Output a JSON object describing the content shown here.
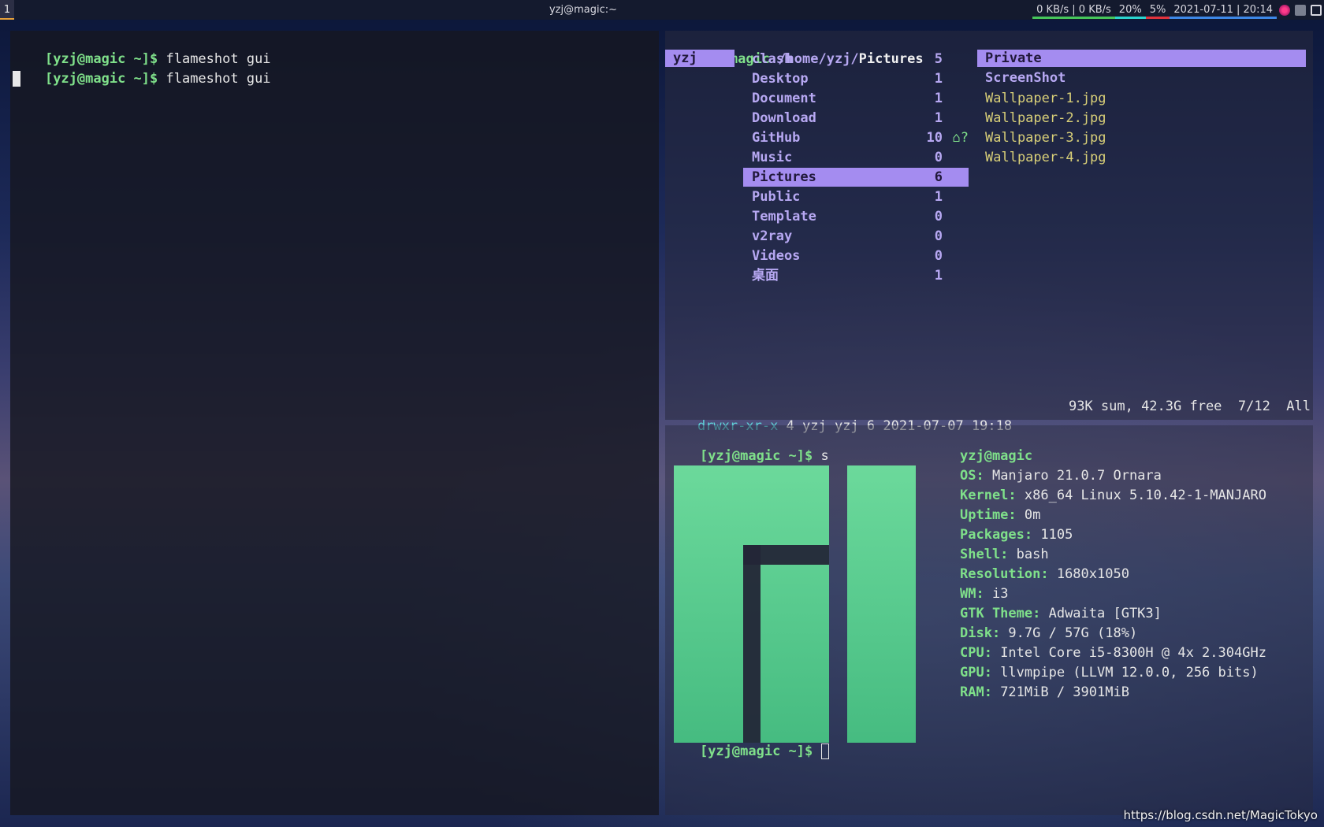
{
  "topbar": {
    "workspace": "1",
    "window_title": "yzj@magic:~",
    "net": "0 KB/s | 0 KB/s",
    "cpu": "20%",
    "mem": "5%",
    "datetime": "2021-07-11 | 20:14",
    "tray_icons": [
      "flameshot-icon",
      "clipboard-icon",
      "network-icon"
    ],
    "colors": {
      "net": "#46c55a",
      "cpu": "#2bd4cf",
      "mem": "#e0333d",
      "date": "#3d87e6",
      "workspace": "#e8a13a"
    }
  },
  "left_terminal": {
    "lines": [
      {
        "prompt": "[yzj@magic ~]$",
        "cmd": " flameshot gui"
      },
      {
        "prompt": "[yzj@magic ~]$",
        "cmd": " flameshot gui"
      }
    ]
  },
  "ranger": {
    "header_user": "yzj@magic",
    "header_path": " /home/yzj/",
    "header_dir": "Pictures",
    "parent": "yzj",
    "dirs": [
      {
        "name": "clash",
        "count": "5"
      },
      {
        "name": "Desktop",
        "count": "1"
      },
      {
        "name": "Document",
        "count": "1"
      },
      {
        "name": "Download",
        "count": "1"
      },
      {
        "name": "GitHub",
        "count": "10",
        "flag": "⌂?"
      },
      {
        "name": "Music",
        "count": "0"
      },
      {
        "name": "Pictures",
        "count": "6"
      },
      {
        "name": "Public",
        "count": "1"
      },
      {
        "name": "Template",
        "count": "0"
      },
      {
        "name": "v2ray",
        "count": "0"
      },
      {
        "name": "Videos",
        "count": "0"
      },
      {
        "name": "桌面",
        "count": "1"
      }
    ],
    "selected_dir_index": 6,
    "preview_dirs": [
      "Private",
      "ScreenShot"
    ],
    "preview_files": [
      "Wallpaper-1.jpg",
      "Wallpaper-2.jpg",
      "Wallpaper-3.jpg",
      "Wallpaper-4.jpg"
    ],
    "status_perm": "drwxr-xr-x",
    "status_info": " 4 yzj yzj 6 2021-07-07 19:18",
    "status_right": "93K sum, 42.3G free  7/12  All"
  },
  "fetch": {
    "prompt": "[yzj@magic ~]$",
    "cmd": " s",
    "title": "yzj@magic",
    "info": [
      {
        "key": "OS:",
        "value": " Manjaro 21.0.7 Ornara"
      },
      {
        "key": "Kernel:",
        "value": " x86_64 Linux 5.10.42-1-MANJARO"
      },
      {
        "key": "Uptime:",
        "value": " 0m"
      },
      {
        "key": "Packages:",
        "value": " 1105"
      },
      {
        "key": "Shell:",
        "value": " bash"
      },
      {
        "key": "Resolution:",
        "value": " 1680x1050"
      },
      {
        "key": "WM:",
        "value": " i3"
      },
      {
        "key": "GTK Theme:",
        "value": " Adwaita [GTK3]"
      },
      {
        "key": "Disk:",
        "value": " 9.7G / 57G (18%)"
      },
      {
        "key": "CPU:",
        "value": " Intel Core i5-8300H @ 4x 2.304GHz"
      },
      {
        "key": "GPU:",
        "value": " llvmpipe (LLVM 12.0.0, 256 bits)"
      },
      {
        "key": "RAM:",
        "value": " 721MiB / 3901MiB"
      }
    ],
    "final_prompt": "[yzj@magic ~]$"
  },
  "watermark": "https://blog.csdn.net/MagicTokyo"
}
